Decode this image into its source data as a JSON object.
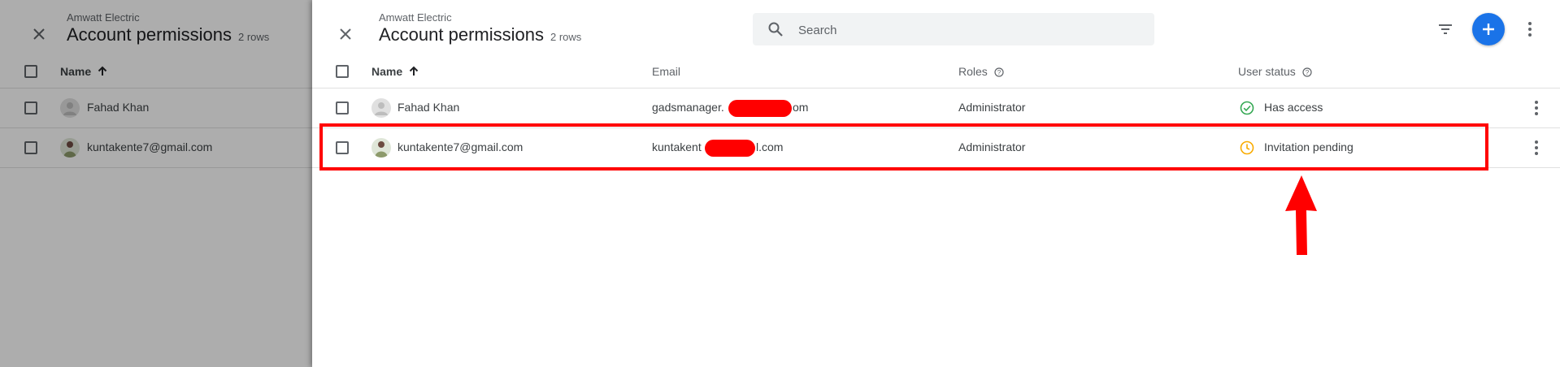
{
  "colors": {
    "accent": "#1a73e8",
    "annotation": "#ff0000",
    "status_ok": "#34a853",
    "status_pending": "#f9ab00"
  },
  "background_panel": {
    "subtitle": "Amwatt Electric",
    "title": "Account permissions",
    "row_count": "2 rows",
    "columns": {
      "name": "Name"
    },
    "rows": [
      {
        "name": "Fahad Khan"
      },
      {
        "name": "kuntakente7@gmail.com"
      }
    ]
  },
  "header": {
    "subtitle": "Amwatt Electric",
    "title": "Account permissions",
    "row_count": "2 rows"
  },
  "search": {
    "placeholder": "Search",
    "icon": "search-icon"
  },
  "toolbar": {
    "filter_icon": "filter-icon",
    "add_icon": "add-icon",
    "more_icon": "more-vert-icon"
  },
  "table": {
    "columns": {
      "name": "Name",
      "email": "Email",
      "roles": "Roles",
      "status": "User status"
    },
    "sort": {
      "column": "Name",
      "direction": "ascending"
    },
    "rows": [
      {
        "name": "Fahad Khan",
        "email_start": "gadsmanager.",
        "email_end": "om",
        "role": "Administrator",
        "status": "Has access",
        "status_icon": "check-circle-icon",
        "avatar": "default-avatar"
      },
      {
        "name": "kuntakente7@gmail.com",
        "email_start": "kuntakent",
        "email_end": "l.com",
        "role": "Administrator",
        "status": "Invitation pending",
        "status_icon": "clock-icon",
        "avatar": "photo-avatar"
      }
    ]
  }
}
